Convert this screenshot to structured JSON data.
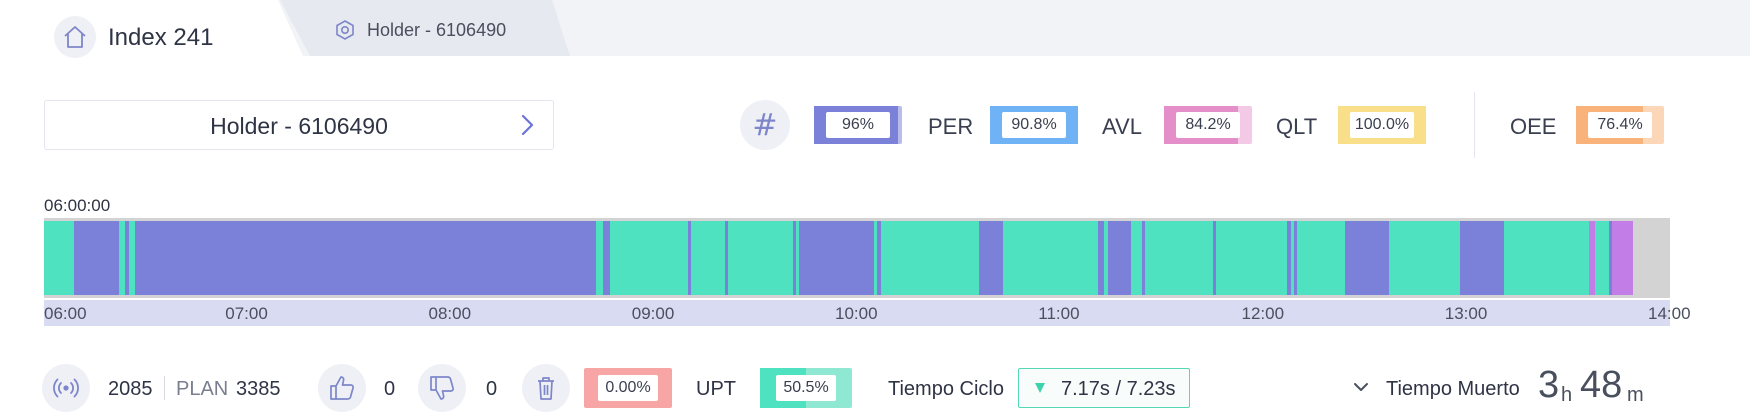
{
  "tabs": {
    "home_title": "Index 241",
    "holder_label": "Holder - 6106490"
  },
  "header": {
    "asset_label": "Holder - 6106490",
    "kpis": [
      {
        "name": "",
        "value": "96%",
        "level": 0.96,
        "color": "#7b80d8",
        "bg": "#b9bce9"
      },
      {
        "name": "PER",
        "value": "90.8%",
        "level": 1.0,
        "color": "#6fb3f6",
        "bg": "#6fb3f6"
      },
      {
        "name": "AVL",
        "value": "84.2%",
        "level": 0.84,
        "color": "#e58fca",
        "bg": "#f4c9e5"
      },
      {
        "name": "QLT",
        "value": "100.0%",
        "level": 1.0,
        "color": "#f9df8a",
        "bg": "#f9df8a"
      },
      {
        "name": "OEE",
        "value": "76.4%",
        "level": 0.76,
        "color": "#f8b27a",
        "bg": "#fbd7b7"
      }
    ]
  },
  "timeline": {
    "start_label": "06:00:00",
    "ticks": [
      "06:00",
      "07:00",
      "08:00",
      "09:00",
      "10:00",
      "11:00",
      "12:00",
      "13:00",
      "14:00"
    ],
    "colors": {
      "run": "#4ee2c0",
      "stop": "#7b80d8",
      "other": "#c27ee6",
      "empty": "#d3d3d3"
    },
    "segments": [
      {
        "start": "06:00",
        "end": "06:09",
        "state": "run"
      },
      {
        "start": "06:09",
        "end": "06:22",
        "state": "stop"
      },
      {
        "start": "06:22",
        "end": "06:24",
        "state": "run"
      },
      {
        "start": "06:24",
        "end": "06:25",
        "state": "stop"
      },
      {
        "start": "06:25",
        "end": "06:27",
        "state": "run"
      },
      {
        "start": "06:27",
        "end": "08:43",
        "state": "stop"
      },
      {
        "start": "08:43",
        "end": "08:45",
        "state": "run"
      },
      {
        "start": "08:45",
        "end": "08:47",
        "state": "stop"
      },
      {
        "start": "08:47",
        "end": "09:10",
        "state": "run"
      },
      {
        "start": "09:10",
        "end": "09:11",
        "state": "stop"
      },
      {
        "start": "09:11",
        "end": "09:21",
        "state": "run"
      },
      {
        "start": "09:21",
        "end": "09:22",
        "state": "stop"
      },
      {
        "start": "09:22",
        "end": "09:41",
        "state": "run"
      },
      {
        "start": "09:41",
        "end": "09:42",
        "state": "stop"
      },
      {
        "start": "09:42",
        "end": "09:43",
        "state": "run"
      },
      {
        "start": "09:43",
        "end": "10:05",
        "state": "stop"
      },
      {
        "start": "10:05",
        "end": "10:06",
        "state": "run"
      },
      {
        "start": "10:06",
        "end": "10:07",
        "state": "stop"
      },
      {
        "start": "10:07",
        "end": "10:36",
        "state": "run"
      },
      {
        "start": "10:36",
        "end": "10:43",
        "state": "stop"
      },
      {
        "start": "10:43",
        "end": "11:11",
        "state": "run"
      },
      {
        "start": "11:11",
        "end": "11:13",
        "state": "stop"
      },
      {
        "start": "11:13",
        "end": "11:14",
        "state": "run"
      },
      {
        "start": "11:14",
        "end": "11:21",
        "state": "stop"
      },
      {
        "start": "11:21",
        "end": "11:24",
        "state": "run"
      },
      {
        "start": "11:24",
        "end": "11:25",
        "state": "stop"
      },
      {
        "start": "11:25",
        "end": "11:45",
        "state": "run"
      },
      {
        "start": "11:45",
        "end": "11:46",
        "state": "stop"
      },
      {
        "start": "11:46",
        "end": "12:07",
        "state": "run"
      },
      {
        "start": "12:07",
        "end": "12:08",
        "state": "stop"
      },
      {
        "start": "12:08",
        "end": "12:09",
        "state": "run"
      },
      {
        "start": "12:09",
        "end": "12:10",
        "state": "stop"
      },
      {
        "start": "12:10",
        "end": "12:24",
        "state": "run"
      },
      {
        "start": "12:24",
        "end": "12:37",
        "state": "stop"
      },
      {
        "start": "12:37",
        "end": "12:58",
        "state": "run"
      },
      {
        "start": "12:58",
        "end": "13:11",
        "state": "stop"
      },
      {
        "start": "13:11",
        "end": "13:36",
        "state": "run"
      },
      {
        "start": "13:36",
        "end": "13:38",
        "state": "other"
      },
      {
        "start": "13:38",
        "end": "13:42",
        "state": "run"
      },
      {
        "start": "13:42",
        "end": "13:43",
        "state": "stop"
      },
      {
        "start": "13:43",
        "end": "13:49",
        "state": "other"
      },
      {
        "start": "13:49",
        "end": "14:00",
        "state": "empty"
      }
    ]
  },
  "bottom": {
    "count": "2085",
    "plan_label": "PLAN",
    "plan_value": "3385",
    "good_count": "0",
    "bad_count": "0",
    "scrap_pct": "0.00%",
    "upt_label": "UPT",
    "upt_value": "50.5%",
    "upt_level": 0.505,
    "cycle_label": "Tiempo Ciclo",
    "cycle_value": "7.17s  /  7.23s",
    "dead_label": "Tiempo Muerto",
    "dead_hours": "3",
    "dead_hours_unit": "h",
    "dead_minutes": "48",
    "dead_minutes_unit": "m"
  }
}
